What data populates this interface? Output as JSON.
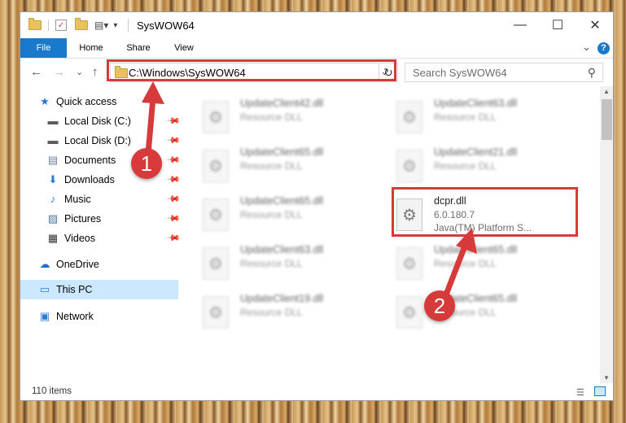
{
  "window": {
    "title": "SysWOW64",
    "min_glyph": "—",
    "max_glyph": "☐",
    "close_glyph": "✕"
  },
  "ribbon": {
    "tabs": [
      "File",
      "Home",
      "Share",
      "View"
    ],
    "collapse_glyph": "⌄",
    "help_glyph": "?"
  },
  "address": {
    "path": "C:\\Windows\\SysWOW64",
    "dropdown_glyph": "⌄",
    "refresh_glyph": "↻",
    "back_glyph": "←",
    "forward_glyph": "→",
    "recent_glyph": "⌄",
    "up_glyph": "↑"
  },
  "search": {
    "placeholder": "Search SysWOW64",
    "icon_glyph": "⚲"
  },
  "sidebar": {
    "quick_access": "Quick access",
    "items": [
      {
        "label": "Local Disk (C:)",
        "icon": "drive-icon",
        "glyph": "▬",
        "color": "#5a5a5a"
      },
      {
        "label": "Local Disk (D:)",
        "icon": "drive-icon",
        "glyph": "▬",
        "color": "#5a5a5a"
      },
      {
        "label": "Documents",
        "icon": "documents-icon",
        "glyph": "▤",
        "color": "#6a7f9a"
      },
      {
        "label": "Downloads",
        "icon": "downloads-icon",
        "glyph": "⬇",
        "color": "#2a7bd6"
      },
      {
        "label": "Music",
        "icon": "music-icon",
        "glyph": "♪",
        "color": "#2a7bd6"
      },
      {
        "label": "Pictures",
        "icon": "pictures-icon",
        "glyph": "▨",
        "color": "#4a7aa8"
      },
      {
        "label": "Videos",
        "icon": "videos-icon",
        "glyph": "▦",
        "color": "#333333"
      }
    ],
    "onedrive": "OneDrive",
    "thispc": "This PC",
    "network": "Network",
    "pin_glyph": "📌"
  },
  "files": {
    "left_column": [
      {
        "name": "UpdateClient42.dll",
        "type": "Resource DLL"
      },
      {
        "name": "UpdateClient65.dll",
        "type": "Resource DLL"
      },
      {
        "name": "UpdateClient65.dll",
        "type": "Resource DLL"
      },
      {
        "name": "UpdateClient63.dll",
        "type": "Resource DLL"
      },
      {
        "name": "UpdateClient19.dll",
        "type": "Resource DLL"
      }
    ],
    "right_column": [
      {
        "name": "UpdateClient63.dll",
        "type": "Resource DLL"
      },
      {
        "name": "UpdateClient21.dll",
        "type": "Resource DLL"
      },
      {
        "name": "UpdateClient65.dll",
        "type": "Resource DLL"
      },
      {
        "name": "UpdateClient65.dll",
        "type": "Resource DLL"
      }
    ],
    "highlighted": {
      "name": "dcpr.dll",
      "version": "6.0.180.7",
      "description": "Java(TM) Platform S..."
    },
    "file_glyph": "⚙"
  },
  "status": {
    "count": "110 items"
  },
  "annotations": {
    "step1": "1",
    "step2": "2",
    "color": "#d63a3a"
  }
}
